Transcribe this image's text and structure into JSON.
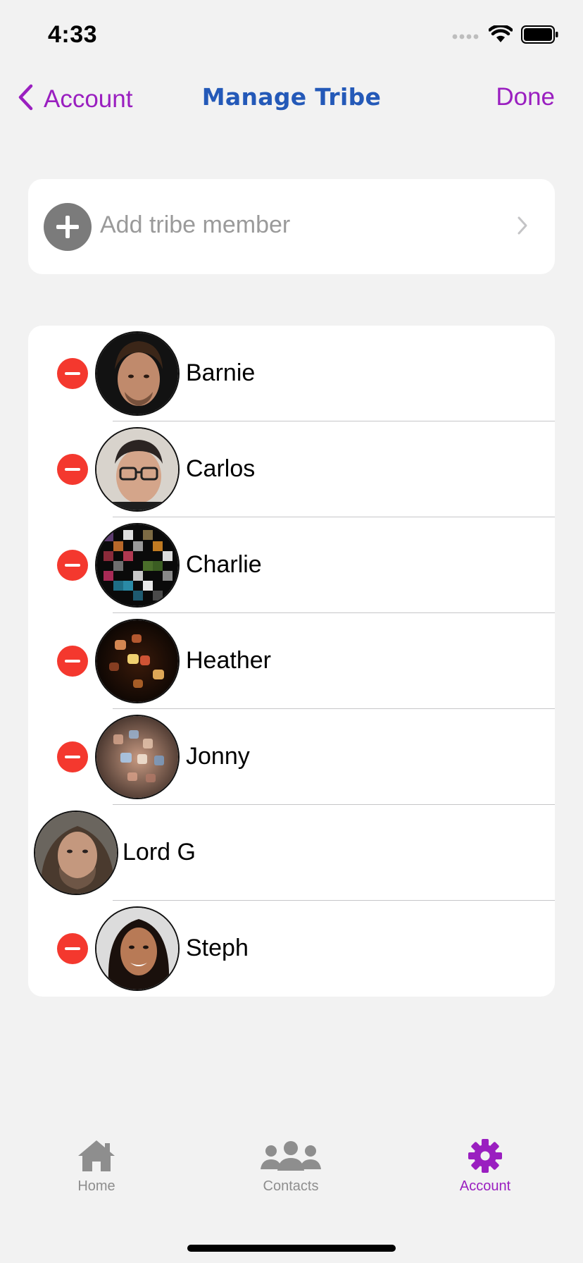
{
  "status_bar": {
    "time": "4:33"
  },
  "nav": {
    "back_label": "Account",
    "title": "Manage Tribe",
    "done_label": "Done"
  },
  "add_member": {
    "label": "Add tribe member"
  },
  "members": [
    {
      "name": "Barnie",
      "removable": true
    },
    {
      "name": "Carlos",
      "removable": true
    },
    {
      "name": "Charlie",
      "removable": true
    },
    {
      "name": "Heather",
      "removable": true
    },
    {
      "name": "Jonny",
      "removable": true
    },
    {
      "name": "Lord G",
      "removable": false
    },
    {
      "name": "Steph",
      "removable": true
    }
  ],
  "tabs": [
    {
      "label": "Home",
      "icon": "home-icon",
      "active": false
    },
    {
      "label": "Contacts",
      "icon": "contacts-icon",
      "active": false
    },
    {
      "label": "Account",
      "icon": "gear-icon",
      "active": true
    }
  ],
  "colors": {
    "accent": "#9a1fc0",
    "title": "#2459b8",
    "remove": "#f4382e",
    "inactive_tab": "#8e8e8e",
    "background": "#f2f2f2"
  }
}
